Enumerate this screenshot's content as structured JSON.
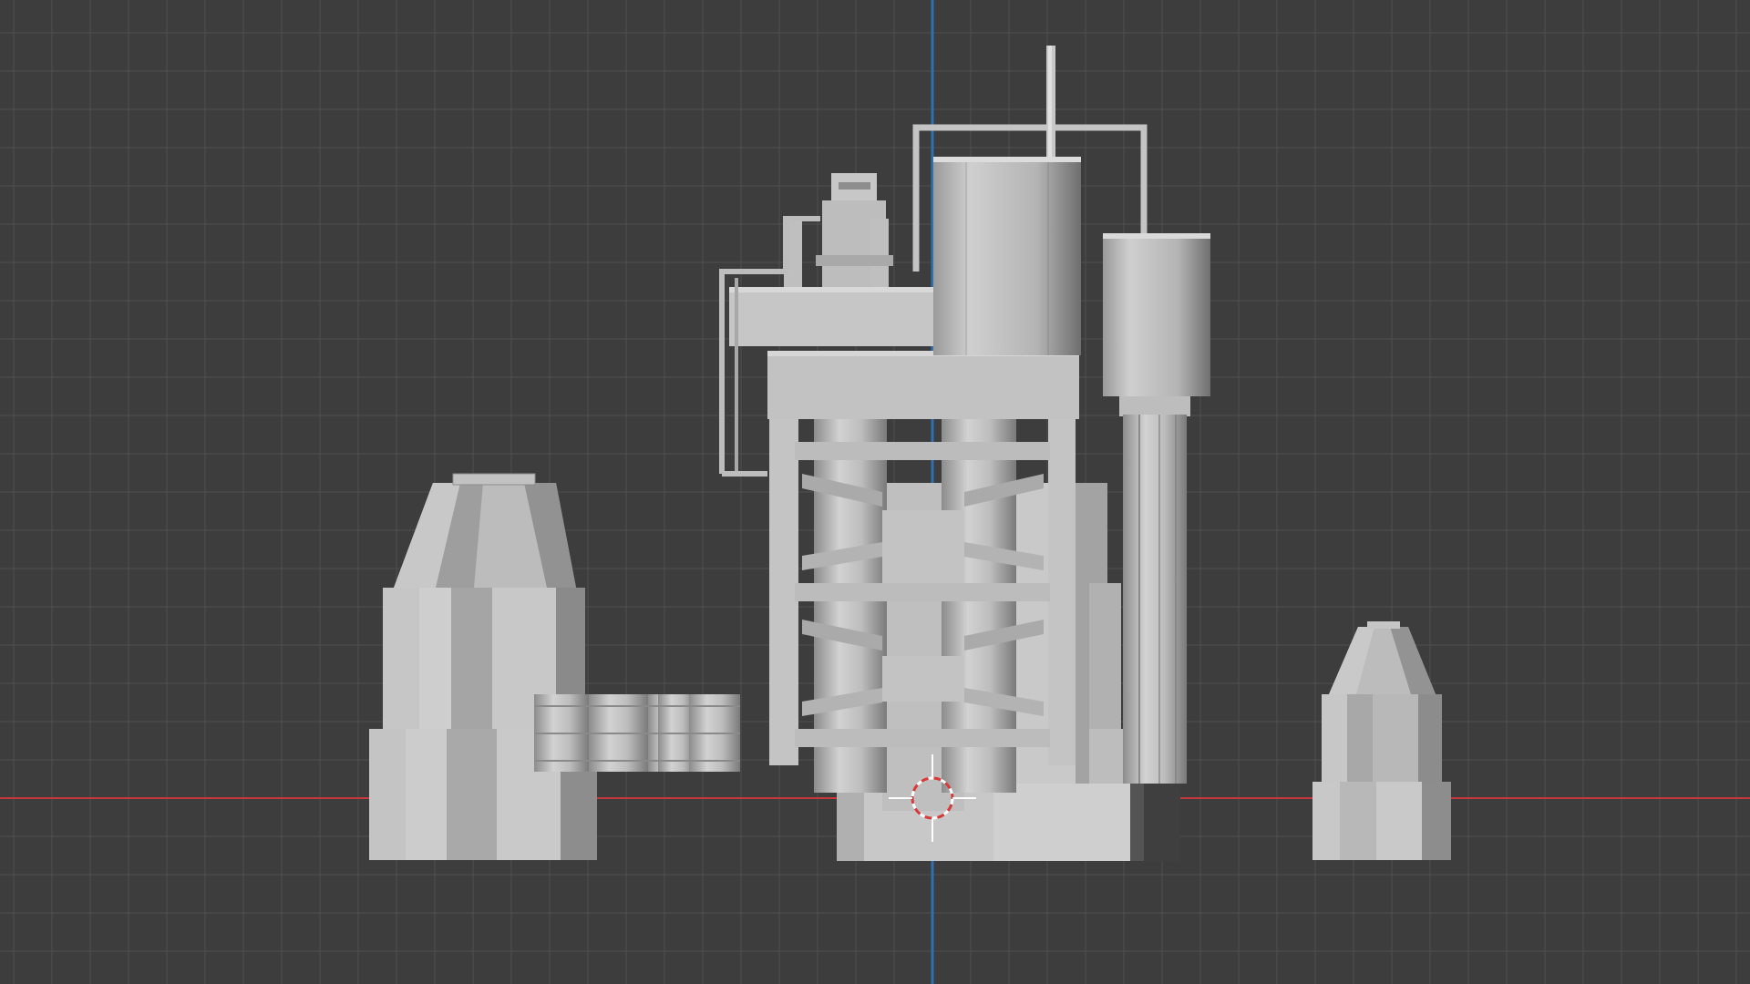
{
  "viewport": {
    "view": "front-orthographic",
    "shading": "solid",
    "background_color": "#3d3d3d",
    "grid_line_color": "#505050",
    "x_axis_color": "#c8383f",
    "z_axis_color": "#2f6fb2",
    "object_color": "#b9b9b9"
  },
  "scene": {
    "objects": [
      {
        "name": "left-tower",
        "shape": "octagonal stepped tower with tapered top"
      },
      {
        "name": "barrels",
        "shape": "row of cylindrical drums"
      },
      {
        "name": "main-reactor",
        "shape": "braced structure with two tall cylinders"
      },
      {
        "name": "tall-tank",
        "shape": "large vertical cylinder"
      },
      {
        "name": "side-column",
        "shape": "column with small tank on top"
      },
      {
        "name": "right-tower",
        "shape": "small octagonal stepped tower"
      }
    ],
    "cursor": {
      "icon": "3d-cursor-icon"
    }
  }
}
